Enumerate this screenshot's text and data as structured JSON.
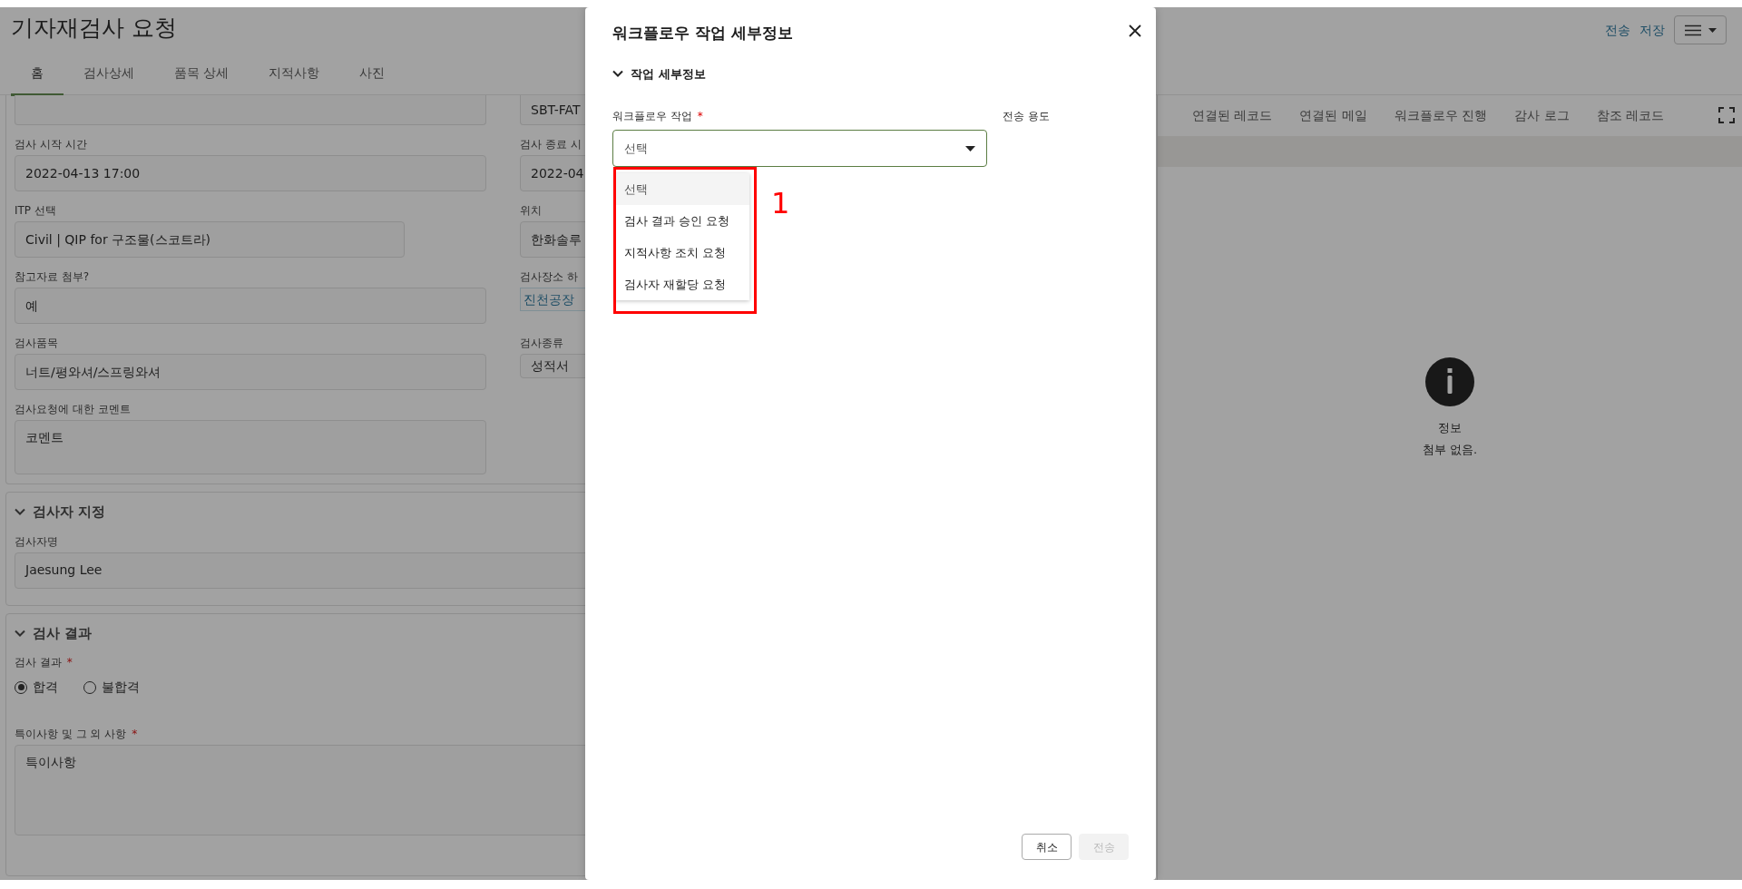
{
  "header": {
    "title": "기자재검사 요청",
    "actions": [
      {
        "label": "전송"
      },
      {
        "label": "저장"
      }
    ]
  },
  "tabs": [
    {
      "label": "홈",
      "selected": true
    },
    {
      "label": "검사상세",
      "selected": false
    },
    {
      "label": "품목 상세",
      "selected": false
    },
    {
      "label": "지적사항",
      "selected": false
    },
    {
      "label": "사진",
      "selected": false
    }
  ],
  "form_rows": [
    {
      "left": {
        "kind": "cut"
      },
      "right": {
        "kind": "cut",
        "value": "SBT-FAT"
      }
    },
    {
      "left": {
        "kind": "input",
        "label": "검사 시작 시간",
        "value": "2022-04-13 17:00"
      },
      "right": {
        "kind": "input",
        "label": "검사 종료 시",
        "value": "2022-04"
      }
    },
    {
      "left": {
        "kind": "short",
        "label": "ITP 선택",
        "value": "Civil | QIP for 구조물(스코트라)"
      },
      "right": {
        "kind": "input",
        "label": "위치",
        "value": "한화솔루"
      }
    },
    {
      "left": {
        "kind": "input",
        "label": "참고자료 첨부?",
        "value": "예"
      },
      "right": {
        "kind": "link",
        "label": "검사장소 하",
        "value": "진천공장"
      }
    },
    {
      "left": {
        "kind": "input",
        "label": "검사품목",
        "value": "너트/평와셔/스프링와셔"
      },
      "right": {
        "kind": "small",
        "label": "검사종류",
        "value": "성적서"
      }
    },
    {
      "left": {
        "kind": "textarea",
        "label": "검사요청에 대한 코멘트",
        "value": "코멘트"
      }
    }
  ],
  "inspector_section": {
    "title": "검사자 지정",
    "expanded": true,
    "label": "검사자명",
    "value": "Jaesung Lee"
  },
  "result_section": {
    "title": "검사 결과",
    "expanded": true,
    "result_label": "검사 결과",
    "result_required_mark": "*",
    "options": [
      {
        "label": "합격",
        "selected": true
      },
      {
        "label": "불합격",
        "selected": false
      }
    ],
    "notes_label": "특이사항 및 그 외 사항",
    "notes_required_mark": "*",
    "notes_value": "특이사항"
  },
  "side_tabs": [
    {
      "label": "연결된 레코드"
    },
    {
      "label": "연결된 메일"
    },
    {
      "label": "워크플로우 진행"
    },
    {
      "label": "감사 로그"
    },
    {
      "label": "참조 레코드"
    }
  ],
  "side_empty": {
    "title": "정보",
    "message": "첨부 없음."
  },
  "modal": {
    "title": "워크플로우 작업 세부정보",
    "section": "작업 세부정보",
    "section_expanded": true,
    "task_label": "워크플로우 작업",
    "task_required_mark": "*",
    "purpose_label": "전송 용도",
    "select_placeholder": "선택",
    "options": [
      {
        "label": "선택",
        "selected": true
      },
      {
        "label": "검사 결과 승인 요청",
        "selected": false
      },
      {
        "label": "지적사항 조치 요청",
        "selected": false
      },
      {
        "label": "검사자 재할당 요청",
        "selected": false
      }
    ],
    "buttons": [
      {
        "label": "취소",
        "disabled": false
      },
      {
        "label": "전송",
        "disabled": true
      }
    ]
  },
  "annotation": {
    "label": "1"
  }
}
